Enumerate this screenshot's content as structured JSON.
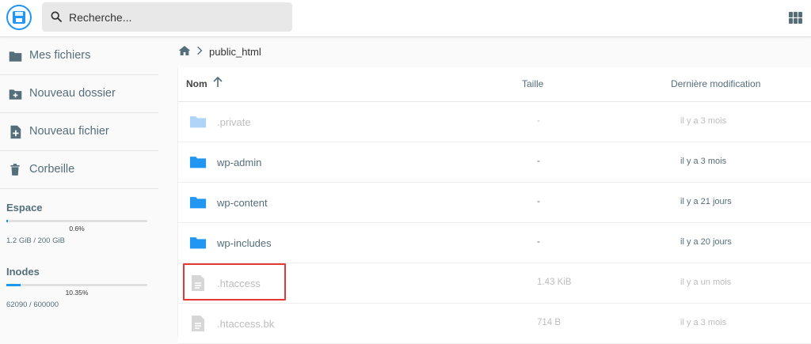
{
  "search": {
    "placeholder": "Recherche..."
  },
  "sidebar": {
    "items": [
      {
        "label": "Mes fichiers",
        "icon": "folder-icon"
      },
      {
        "label": "Nouveau dossier",
        "icon": "create-folder-icon"
      },
      {
        "label": "Nouveau fichier",
        "icon": "create-file-icon"
      },
      {
        "label": "Corbeille",
        "icon": "trash-icon"
      }
    ],
    "space": {
      "title": "Espace",
      "percent_label": "0.6%",
      "percent": 0.6,
      "detail": "1.2 GiB / 200 GiB"
    },
    "inodes": {
      "title": "Inodes",
      "percent_label": "10.35%",
      "percent": 10.35,
      "detail": "62090 / 600000"
    }
  },
  "breadcrumb": {
    "separator": ">",
    "current": "public_html"
  },
  "table": {
    "columns": {
      "name": "Nom",
      "size": "Taille",
      "modified": "Dernière modification"
    },
    "rows": [
      {
        "name": ".private",
        "size": "-",
        "modified": "il y a 3 mois",
        "type": "folder",
        "muted": true
      },
      {
        "name": "wp-admin",
        "size": "-",
        "modified": "il y a 3 mois",
        "type": "folder",
        "muted": false
      },
      {
        "name": "wp-content",
        "size": "-",
        "modified": "il y a 21 jours",
        "type": "folder",
        "muted": false
      },
      {
        "name": "wp-includes",
        "size": "-",
        "modified": "il y a 20 jours",
        "type": "folder",
        "muted": false
      },
      {
        "name": ".htaccess",
        "size": "1.43 KiB",
        "modified": "il y a un mois",
        "type": "file",
        "muted": true
      },
      {
        "name": ".htaccess.bk",
        "size": "714 B",
        "modified": "il y a 3 mois",
        "type": "file",
        "muted": true
      }
    ]
  },
  "colors": {
    "accent": "#2196f3",
    "folder": "#2196f3",
    "folder_muted": "#aed5f7",
    "highlight": "#e53935"
  }
}
